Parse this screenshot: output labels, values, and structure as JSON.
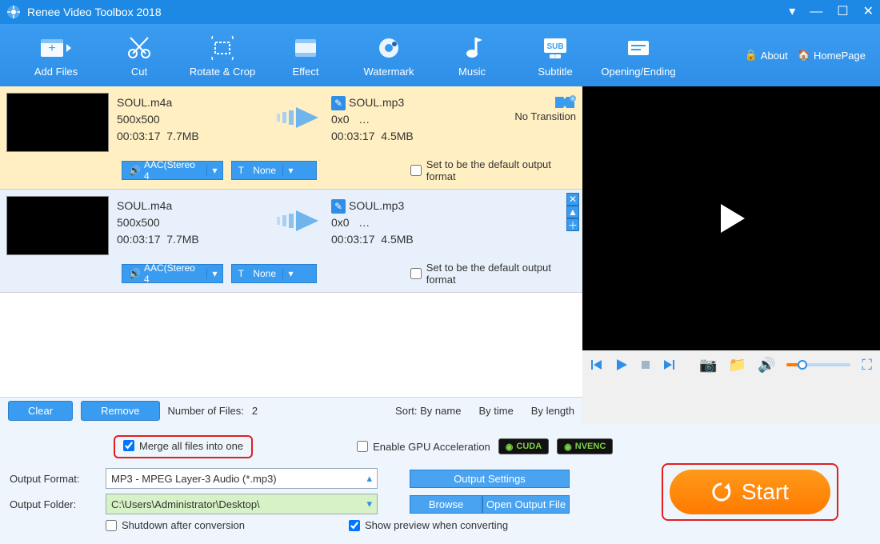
{
  "titlebar": {
    "title": "Renee Video Toolbox 2018"
  },
  "toolbar": {
    "items": [
      {
        "label": "Add Files"
      },
      {
        "label": "Cut"
      },
      {
        "label": "Rotate & Crop"
      },
      {
        "label": "Effect"
      },
      {
        "label": "Watermark"
      },
      {
        "label": "Music"
      },
      {
        "label": "Subtitle"
      },
      {
        "label": "Opening/Ending"
      }
    ],
    "about": "About",
    "homepage": "HomePage"
  },
  "files": [
    {
      "in_name": "SOUL.m4a",
      "in_res": "500x500",
      "in_dur": "00:03:17",
      "in_size": "7.7MB",
      "out_name": "SOUL.mp3",
      "out_res": "0x0",
      "out_more": "…",
      "out_dur": "00:03:17",
      "out_size": "4.5MB",
      "transition": "No Transition",
      "audio": "AAC(Stereo 4",
      "subtitle": "None",
      "default_label": "Set to be the default output format",
      "selected": true
    },
    {
      "in_name": "SOUL.m4a",
      "in_res": "500x500",
      "in_dur": "00:03:17",
      "in_size": "7.7MB",
      "out_name": "SOUL.mp3",
      "out_res": "0x0",
      "out_more": "…",
      "out_dur": "00:03:17",
      "out_size": "4.5MB",
      "transition": "",
      "audio": "AAC(Stereo 4",
      "subtitle": "None",
      "default_label": "Set to be the default output format",
      "selected": false
    }
  ],
  "listfooter": {
    "clear": "Clear",
    "remove": "Remove",
    "count_label": "Number of Files:",
    "count": "2",
    "sort_label": "Sort:",
    "sort_name": "By name",
    "sort_time": "By time",
    "sort_length": "By length"
  },
  "settings": {
    "merge_label": "Merge all files into one",
    "gpu_label": "Enable GPU Acceleration",
    "cuda": "CUDA",
    "nvenc": "NVENC",
    "format_label": "Output Format:",
    "format_value": "MP3 - MPEG Layer-3 Audio (*.mp3)",
    "output_settings": "Output Settings",
    "folder_label": "Output Folder:",
    "folder_value": "C:\\Users\\Administrator\\Desktop\\",
    "browse": "Browse",
    "open_output": "Open Output File",
    "shutdown": "Shutdown after conversion",
    "show_preview": "Show preview when converting",
    "start": "Start"
  }
}
